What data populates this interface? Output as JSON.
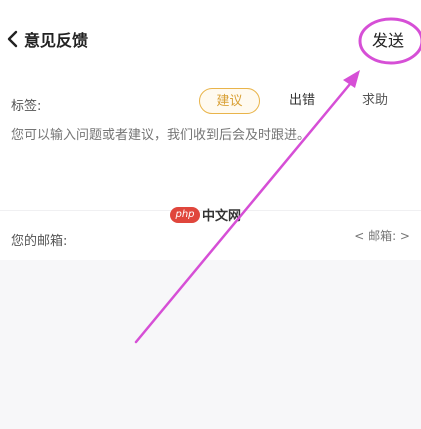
{
  "header": {
    "title": "意见反馈",
    "send_label": "发送"
  },
  "feedback": {
    "tags_label": "标签:",
    "tags": [
      {
        "label": "建议",
        "selected": true
      },
      {
        "label": "出错",
        "selected": false
      },
      {
        "label": "求助",
        "selected": false
      }
    ],
    "placeholder": "您可以输入问题或者建议，我们收到后会及时跟进。"
  },
  "email": {
    "label": "您的邮箱:",
    "placeholder": "< 邮箱: >"
  },
  "watermark": {
    "badge": "php",
    "text": "中文网"
  },
  "colors": {
    "accent": "#e9b44a",
    "annotation": "#d64fd6",
    "background": "#f7f7f9"
  }
}
